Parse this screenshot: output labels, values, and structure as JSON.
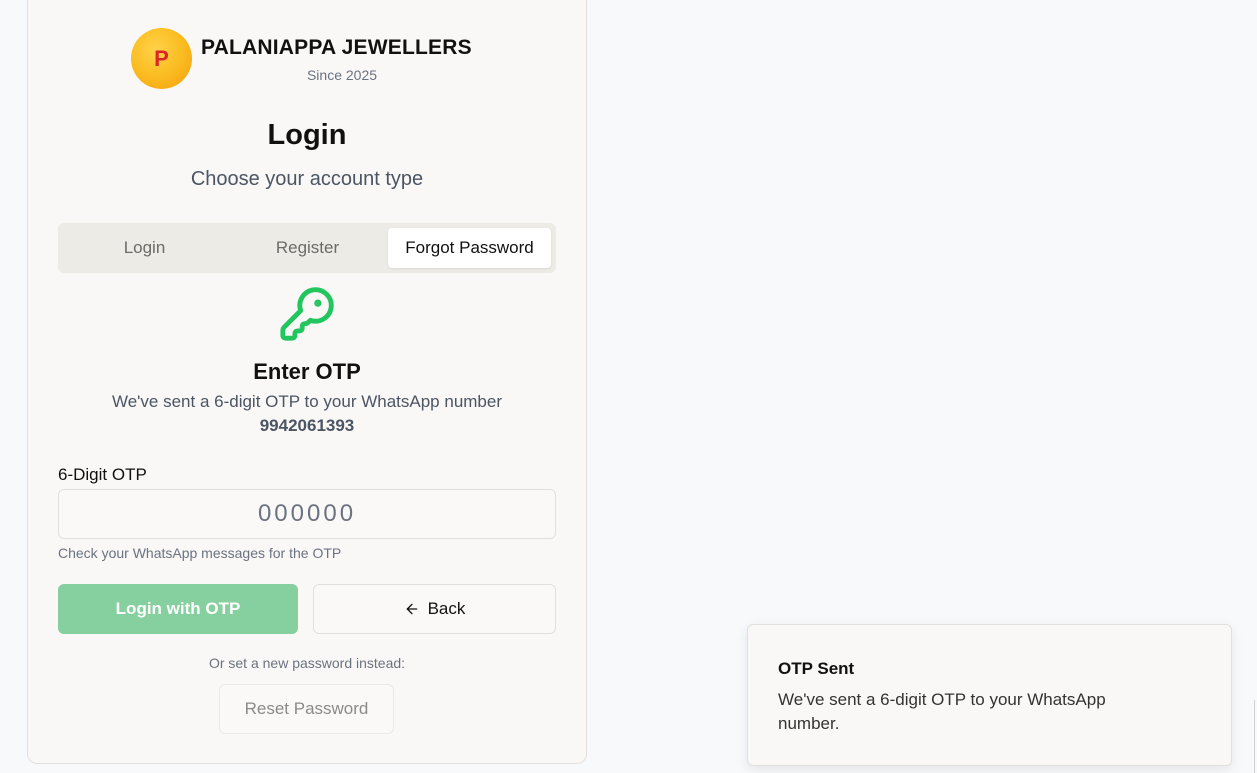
{
  "brand": {
    "logo_letter": "P",
    "name": "PALANIAPPA JEWELLERS",
    "since": "Since 2025"
  },
  "page": {
    "title": "Login",
    "subtitle": "Choose your account type"
  },
  "tabs": [
    {
      "label": "Login",
      "active": false
    },
    {
      "label": "Register",
      "active": false
    },
    {
      "label": "Forgot Password",
      "active": true
    }
  ],
  "otp": {
    "icon": "key-icon",
    "heading": "Enter OTP",
    "description": "We've sent a 6-digit OTP to your WhatsApp number",
    "phone": "9942061393",
    "field_label": "6-Digit OTP",
    "placeholder": "000000",
    "value": "",
    "hint": "Check your WhatsApp messages for the OTP"
  },
  "actions": {
    "login_with_otp": "Login with OTP",
    "back": "Back",
    "alt_text": "Or set a new password instead:",
    "reset_password": "Reset Password"
  },
  "toast": {
    "title": "OTP Sent",
    "message": "We've sent a 6-digit OTP to your WhatsApp number."
  },
  "colors": {
    "accent_green": "#22c55e",
    "primary_button": "#86cf9f",
    "logo_gold": "#fbbf24",
    "logo_letter": "#dc2626"
  }
}
